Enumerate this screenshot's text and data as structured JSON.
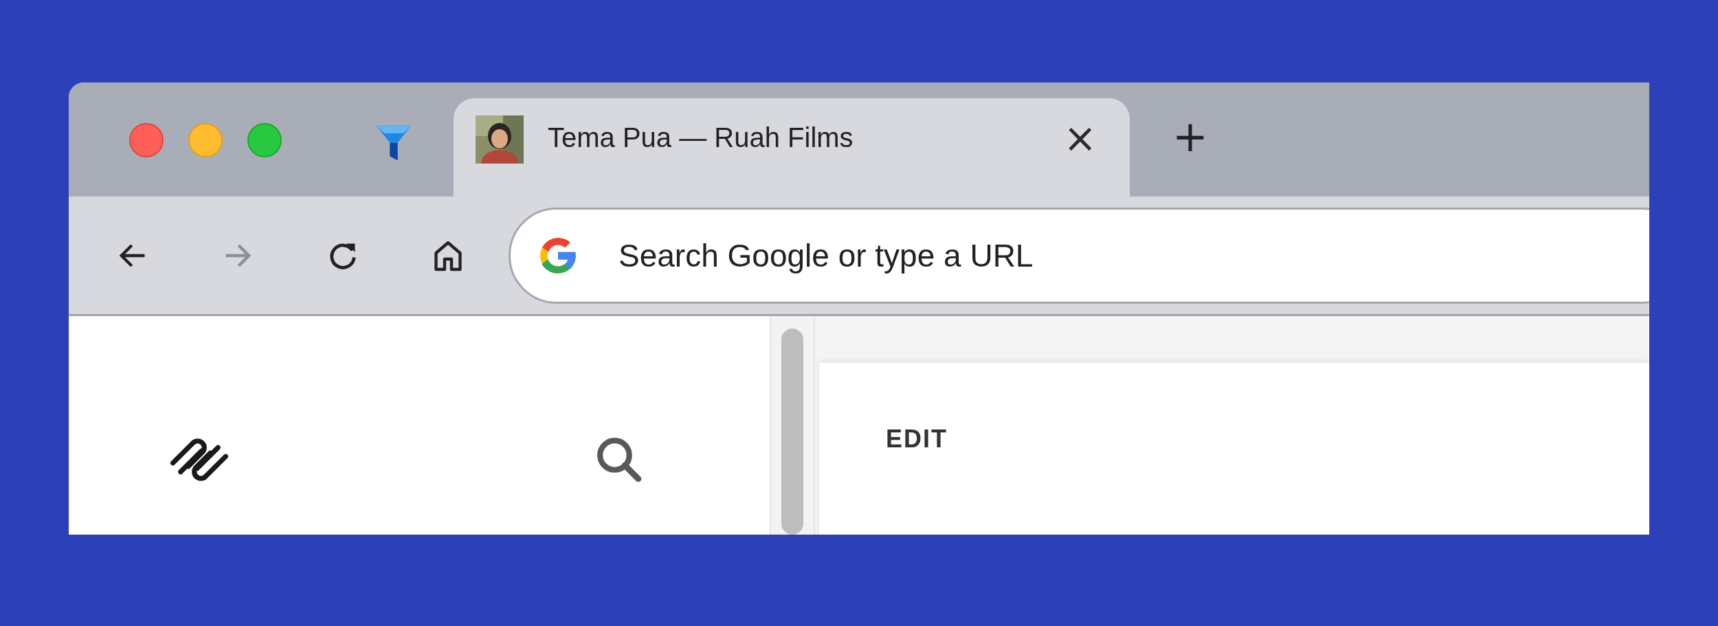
{
  "tabs": [
    {
      "kind": "pinned",
      "selected": false
    },
    {
      "kind": "page",
      "title": "Tema Pua — Ruah Films",
      "close": "×",
      "selected": true
    }
  ],
  "new_tab": "+",
  "toolbar": {
    "buttons": [
      {
        "kind": "back",
        "disabled": false
      },
      {
        "kind": "forward",
        "disabled": true
      },
      {
        "kind": "reload",
        "disabled": false
      },
      {
        "kind": "home",
        "disabled": false
      }
    ],
    "address_bar": {
      "placeholder": "Search Google or type a URL"
    }
  },
  "page": {
    "panel": {
      "heading": "EDIT"
    }
  }
}
